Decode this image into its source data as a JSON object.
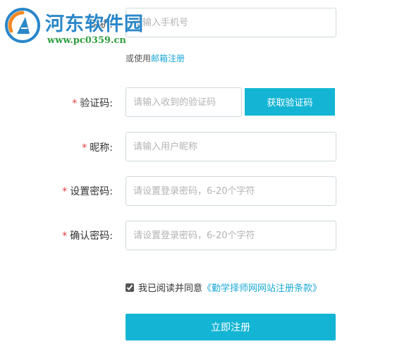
{
  "watermark": {
    "title": "河东软件园",
    "url": "www.pc0359.cn"
  },
  "form": {
    "phone": {
      "label": "手机:",
      "placeholder": "请输入手机号"
    },
    "alt_register": {
      "prefix": "或使用",
      "link": "邮箱注册"
    },
    "code": {
      "required_mark": "*",
      "label": "验证码:",
      "placeholder": "请输入收到的验证码",
      "button": "获取验证码"
    },
    "nickname": {
      "required_mark": "*",
      "label": "昵称:",
      "placeholder": "请输入用户昵称"
    },
    "password": {
      "required_mark": "*",
      "label": "设置密码:",
      "placeholder": "请设置登录密码，6-20个字符"
    },
    "confirm_password": {
      "required_mark": "*",
      "label": "确认密码:",
      "placeholder": "请设置登录密码，6-20个字符"
    },
    "agreement": {
      "checked": true,
      "text": "我已阅读并同意",
      "link": "《勤学择师网网站注册条款》"
    },
    "submit": "立即注册"
  },
  "colors": {
    "accent": "#14b5d4",
    "link": "#1aa8d6",
    "required": "#e4393c",
    "input_border": "#cfd8dc"
  }
}
